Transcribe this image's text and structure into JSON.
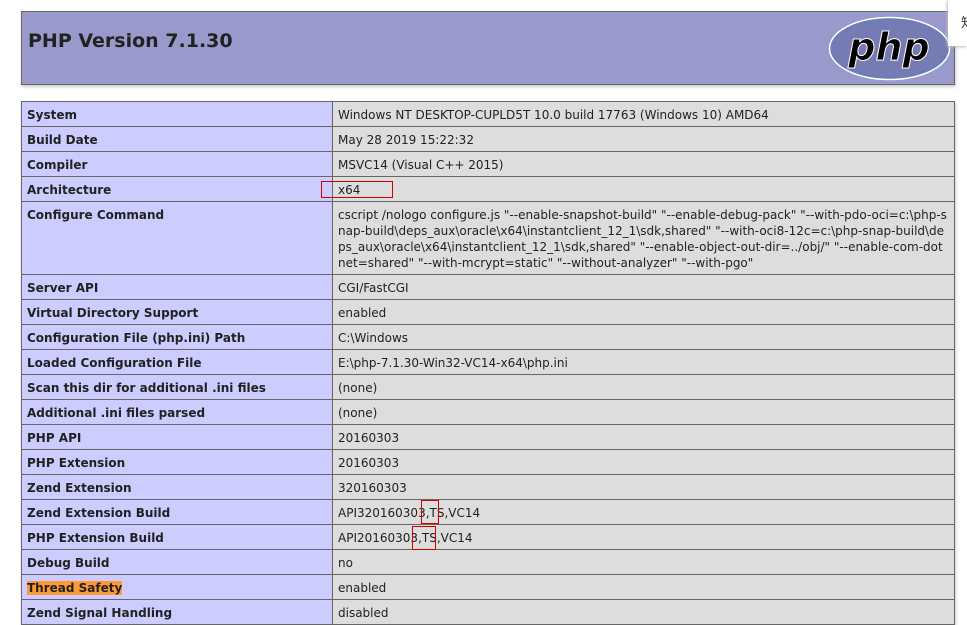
{
  "header": {
    "title": "PHP Version 7.1.30",
    "logo_text": "php"
  },
  "corner_snippet": "知",
  "rows": [
    {
      "key": "System",
      "value": "Windows NT DESKTOP-CUPLD5T 10.0 build 17763 (Windows 10) AMD64"
    },
    {
      "key": "Build Date",
      "value": "May 28 2019 15:22:32"
    },
    {
      "key": "Compiler",
      "value": "MSVC14 (Visual C++ 2015)"
    },
    {
      "key": "Architecture",
      "value": "x64"
    },
    {
      "key": "Configure Command",
      "value": "cscript /nologo configure.js \"--enable-snapshot-build\" \"--enable-debug-pack\" \"--with-pdo-oci=c:\\php-snap-build\\deps_aux\\oracle\\x64\\instantclient_12_1\\sdk,shared\" \"--with-oci8-12c=c:\\php-snap-build\\deps_aux\\oracle\\x64\\instantclient_12_1\\sdk,shared\" \"--enable-object-out-dir=../obj/\" \"--enable-com-dotnet=shared\" \"--with-mcrypt=static\" \"--without-analyzer\" \"--with-pgo\""
    },
    {
      "key": "Server API",
      "value": "CGI/FastCGI"
    },
    {
      "key": "Virtual Directory Support",
      "value": "enabled"
    },
    {
      "key": "Configuration File (php.ini) Path",
      "value": "C:\\Windows"
    },
    {
      "key": "Loaded Configuration File",
      "value": "E:\\php-7.1.30-Win32-VC14-x64\\php.ini"
    },
    {
      "key": "Scan this dir for additional .ini files",
      "value": "(none)"
    },
    {
      "key": "Additional .ini files parsed",
      "value": "(none)"
    },
    {
      "key": "PHP API",
      "value": "20160303"
    },
    {
      "key": "PHP Extension",
      "value": "20160303"
    },
    {
      "key": "Zend Extension",
      "value": "320160303"
    },
    {
      "key": "Zend Extension Build",
      "value": "API320160303,TS,VC14"
    },
    {
      "key": "PHP Extension Build",
      "value": "API20160303,TS,VC14"
    },
    {
      "key": "Debug Build",
      "value": "no"
    },
    {
      "key": "Thread Safety",
      "value": "enabled"
    },
    {
      "key": "Zend Signal Handling",
      "value": "disabled"
    }
  ],
  "colors": {
    "header_bg": "#9999cc",
    "key_bg": "#ccccff",
    "value_bg": "#dddddd",
    "highlight": "#ff9933",
    "annotation_box": "#d20000"
  }
}
